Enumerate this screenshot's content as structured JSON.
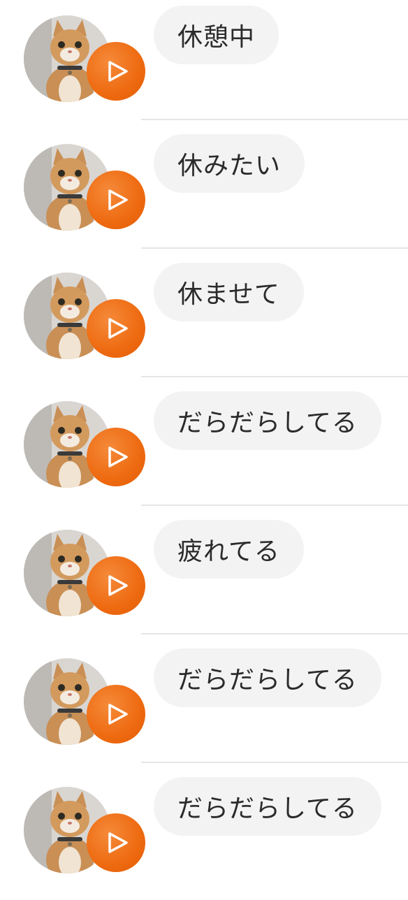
{
  "messages": [
    {
      "text": "休憩中",
      "sender_avatar": "cat-photo",
      "action_icon": "play-icon"
    },
    {
      "text": "休みたい",
      "sender_avatar": "cat-photo",
      "action_icon": "play-icon"
    },
    {
      "text": "休ませて",
      "sender_avatar": "cat-photo",
      "action_icon": "play-icon"
    },
    {
      "text": "だらだらしてる",
      "sender_avatar": "cat-photo",
      "action_icon": "play-icon"
    },
    {
      "text": "疲れてる",
      "sender_avatar": "cat-photo",
      "action_icon": "play-icon"
    },
    {
      "text": "だらだらしてる",
      "sender_avatar": "cat-photo",
      "action_icon": "play-icon"
    },
    {
      "text": "だらだらしてる",
      "sender_avatar": "cat-photo",
      "action_icon": "play-icon"
    }
  ],
  "colors": {
    "play_button": "#ee6a10",
    "bubble_background": "#f3f3f3",
    "bubble_text": "#2b2b2b",
    "divider": "#e6e6e6"
  }
}
